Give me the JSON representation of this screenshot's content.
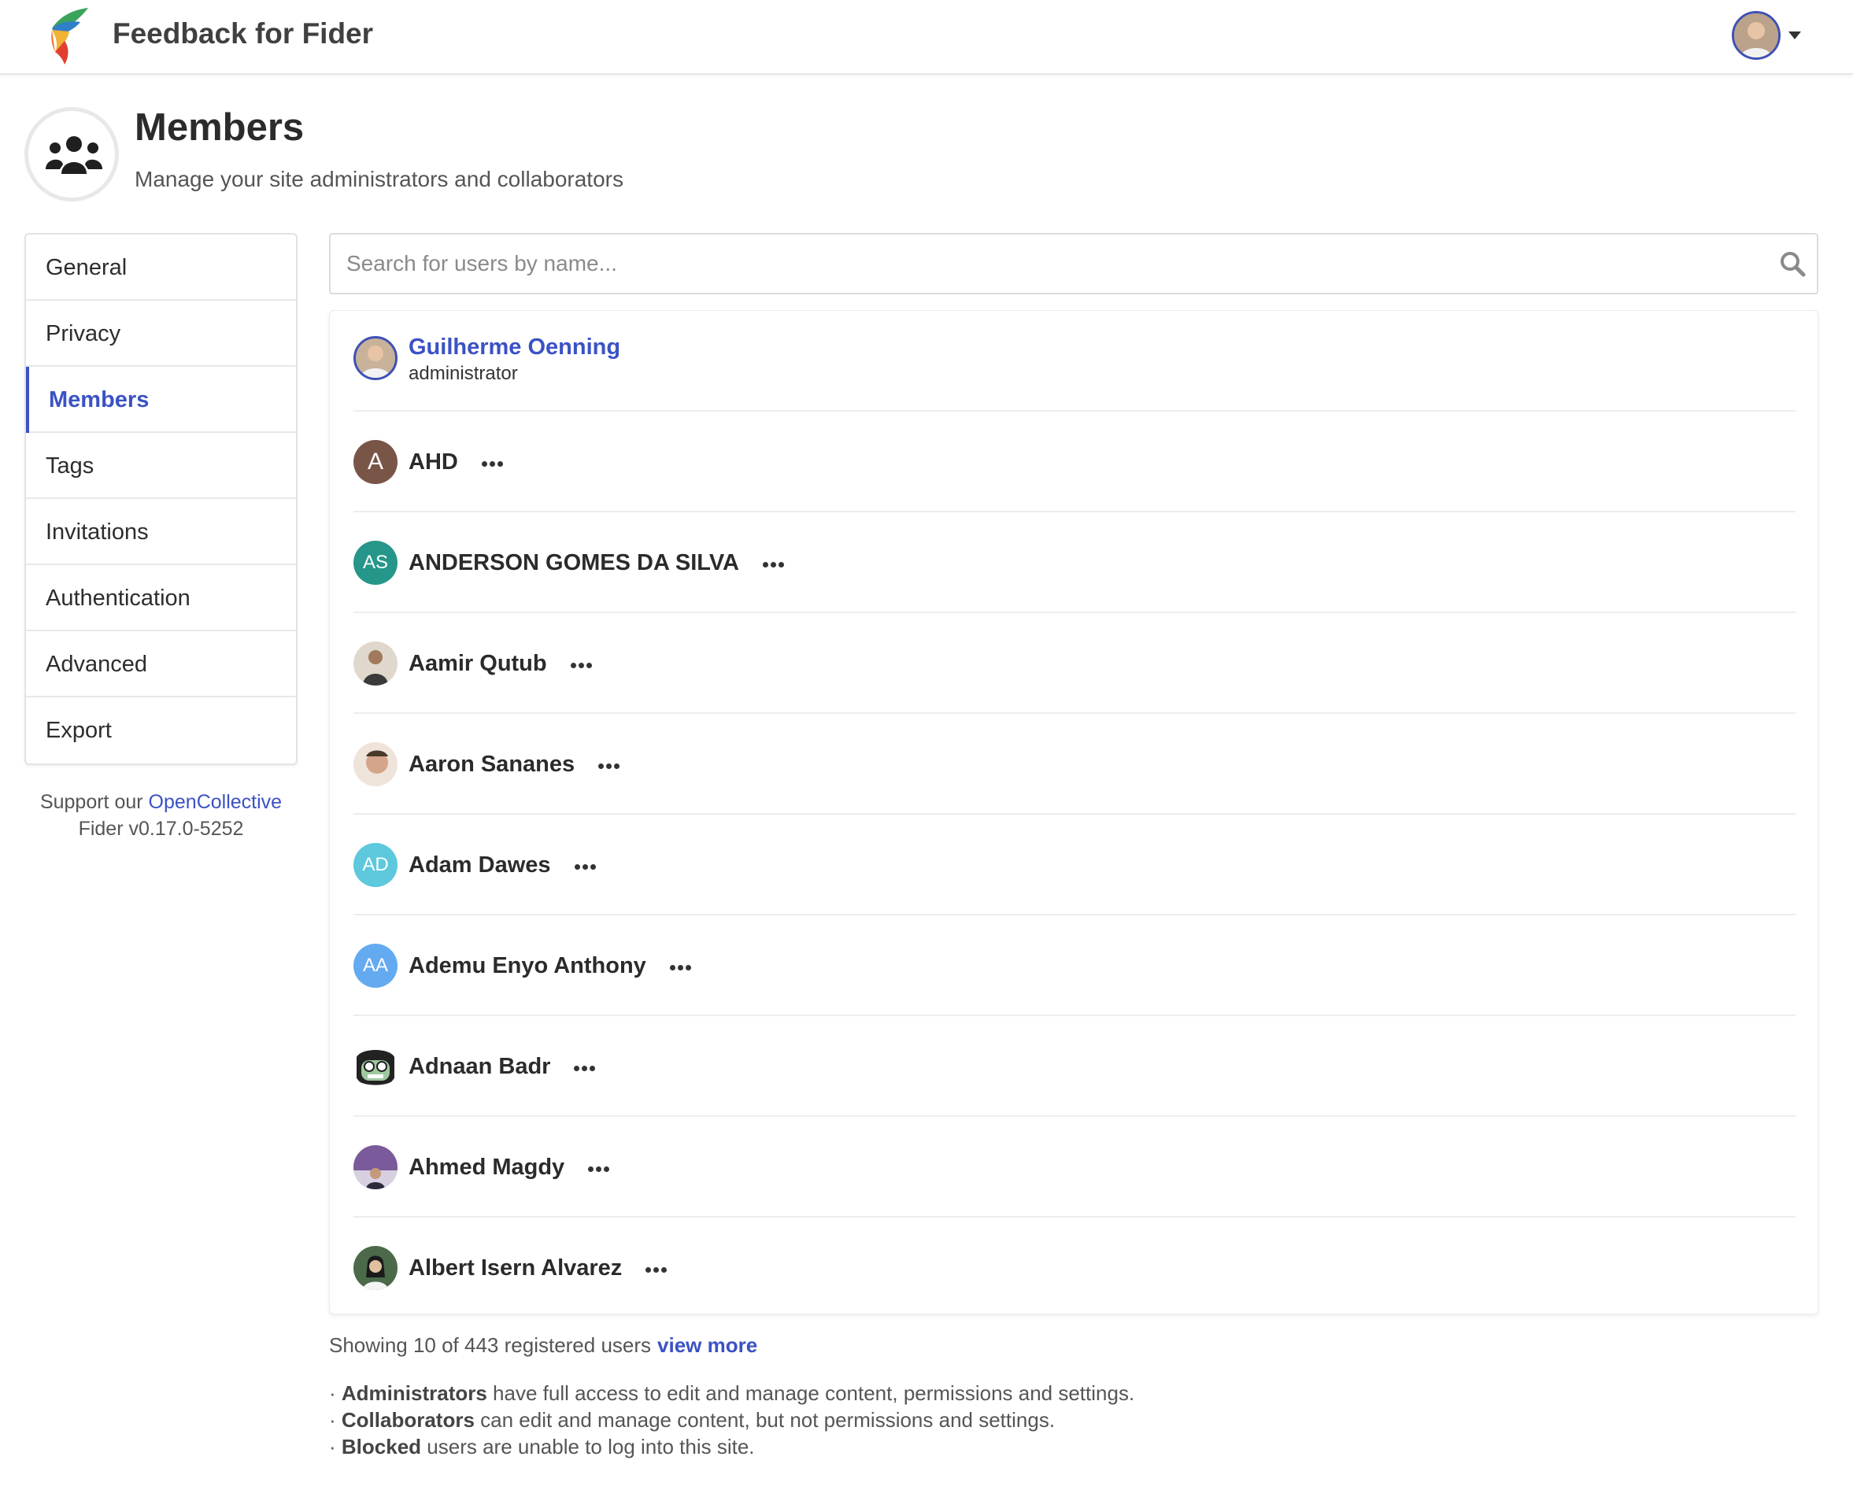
{
  "header": {
    "site_title": "Feedback for Fider"
  },
  "page": {
    "title": "Members",
    "subtitle": "Manage your site administrators and collaborators"
  },
  "sidebar": {
    "items": [
      {
        "label": "General",
        "active": false
      },
      {
        "label": "Privacy",
        "active": false
      },
      {
        "label": "Members",
        "active": true
      },
      {
        "label": "Tags",
        "active": false
      },
      {
        "label": "Invitations",
        "active": false
      },
      {
        "label": "Authentication",
        "active": false
      },
      {
        "label": "Advanced",
        "active": false
      },
      {
        "label": "Export",
        "active": false
      }
    ],
    "support_text": "Support our",
    "support_link": "OpenCollective",
    "version": "Fider v0.17.0-5252"
  },
  "search": {
    "placeholder": "Search for users by name...",
    "value": ""
  },
  "members": [
    {
      "name": "Guilherme Oenning",
      "role": "administrator",
      "avatar": "photo",
      "color": "#c9b29a"
    },
    {
      "name": "AHD",
      "initials": "A",
      "avatar": "initials",
      "color": "#795548"
    },
    {
      "name": "ANDERSON GOMES DA SILVA",
      "initials": "AS",
      "avatar": "initials",
      "color": "#26968a"
    },
    {
      "name": "Aamir Qutub",
      "avatar": "photo",
      "color": "#8a7a6a"
    },
    {
      "name": "Aaron Sananes",
      "avatar": "photo",
      "color": "#d4a58a"
    },
    {
      "name": "Adam Dawes",
      "initials": "AD",
      "avatar": "initials",
      "color": "#5ec8dc"
    },
    {
      "name": "Ademu Enyo Anthony",
      "initials": "AA",
      "avatar": "initials",
      "color": "#64aaf0"
    },
    {
      "name": "Adnaan Badr",
      "avatar": "photo",
      "color": "#3d3d3d"
    },
    {
      "name": "Ahmed Magdy",
      "avatar": "photo",
      "color": "#7a5a9a"
    },
    {
      "name": "Albert Isern Alvarez",
      "avatar": "photo",
      "color": "#4a6a4a"
    }
  ],
  "footer": {
    "showing_text": "Showing 10 of 443 registered users",
    "view_more": "view more",
    "notes": [
      {
        "bold": "Administrators",
        "text": " have full access to edit and manage content, permissions and settings."
      },
      {
        "bold": "Collaborators",
        "text": " can edit and manage content, but not permissions and settings."
      },
      {
        "bold": "Blocked",
        "text": " users are unable to log into this site."
      }
    ]
  },
  "colors": {
    "accent": "#3b52c4",
    "border": "#e3e3e3",
    "text": "#2d2d2d"
  }
}
